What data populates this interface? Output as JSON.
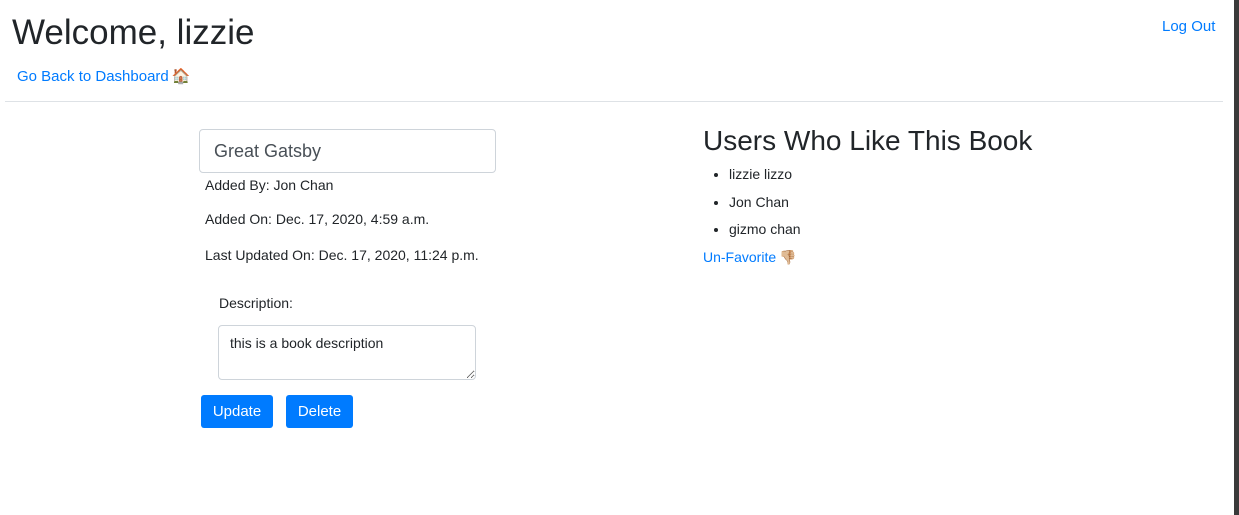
{
  "header": {
    "title": "Welcome, lizzie",
    "logout_label": "Log Out",
    "back_label": "Go Back to Dashboard",
    "back_icon": "🏠"
  },
  "book": {
    "title_value": "Great Gatsby",
    "added_by": "Added By: Jon Chan",
    "added_on": "Added On: Dec. 17, 2020, 4:59 a.m.",
    "last_updated": "Last Updated On: Dec. 17, 2020, 11:24 p.m.",
    "description_label": "Description:",
    "description_value": "this is a book description",
    "update_label": "Update",
    "delete_label": "Delete"
  },
  "likes": {
    "heading": "Users Who Like This Book",
    "users": [
      "lizzie lizzo",
      "Jon Chan",
      "gizmo chan"
    ],
    "unfavorite_label": "Un-Favorite",
    "unfavorite_icon": "👎🏼"
  },
  "colors": {
    "link": "#007bff",
    "button_bg": "#007bff",
    "text": "#212529"
  }
}
